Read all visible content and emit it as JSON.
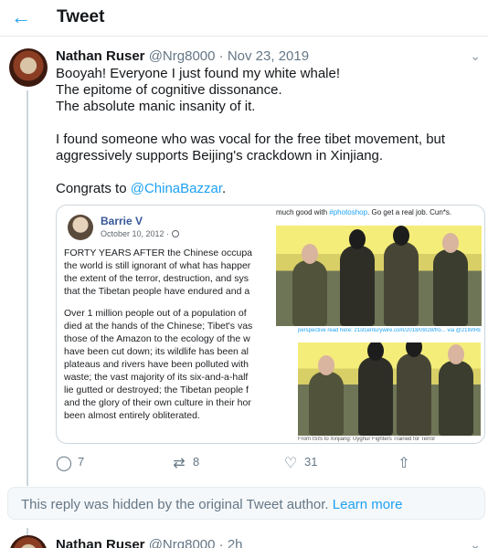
{
  "header": {
    "back_icon": "arrow-left-icon",
    "title": "Tweet"
  },
  "tweet": {
    "name": "Nathan Ruser",
    "handle": "@Nrg8000",
    "separator": "·",
    "date": "Nov 23, 2019",
    "menu_icon": "chevron-down-icon",
    "lines": [
      "Booyah! Everyone I just found my white whale!",
      "The epitome of cognitive dissonance.",
      "The absolute manic insanity of it."
    ],
    "paragraph2": [
      "I found someone who was vocal for the free tibet movement, but",
      "aggressively supports Beijing's crackdown in Xinjiang."
    ],
    "congrats_prefix": "Congrats to ",
    "congrats_mention": "@ChinaBazzar",
    "congrats_suffix": ".",
    "media": {
      "author": "Barrie V",
      "date": "October 10, 2012 ·",
      "text_lines": [
        "FORTY YEARS AFTER the Chinese occupa",
        "the world is still ignorant of what has happer",
        "the extent of the terror, destruction, and sys",
        "that the Tibetan people have endured and a",
        "Over 1 million people out of a population of",
        "died at the hands of the Chinese; Tibet's vas",
        "those of the Amazon to the ecology of the w",
        "have been cut down; its wildlife has been al",
        "plateaus and rivers have been polluted with",
        "waste; the vast majority of its six-and-a-half",
        "lie gutted or destroyed; the Tibetan people f",
        "and the glory of their own culture in their hor",
        "been almost entirely obliterated."
      ],
      "right_caption_prefix": "much good with ",
      "right_caption_tag": "#photoshop",
      "right_caption_suffix": ". Go get a real job. Cun*s.",
      "photo_caption_top": "perspective read here: 21stcenturywire.com/2018/09/28/fro... via @21WIRE #theGuardian",
      "photo_caption_bottom": "From ISIS to Xinjiang: Uyghur Fighters Trained for Terror"
    },
    "actions": {
      "reply_icon": "reply-icon",
      "reply_count": "7",
      "retweet_icon": "retweet-icon",
      "retweet_count": "8",
      "like_icon": "heart-icon",
      "like_count": "31",
      "share_icon": "share-icon"
    }
  },
  "hidden_notice": {
    "text": "This reply was hidden by the original Tweet author.",
    "link": "Learn more"
  },
  "next_tweet": {
    "name": "Nathan Ruser",
    "handle": "@Nrg8000",
    "separator": "·",
    "date": "2h"
  },
  "colors": {
    "accent": "#1da1f2",
    "secondary_text": "#657786",
    "border": "#e6ecf0"
  }
}
